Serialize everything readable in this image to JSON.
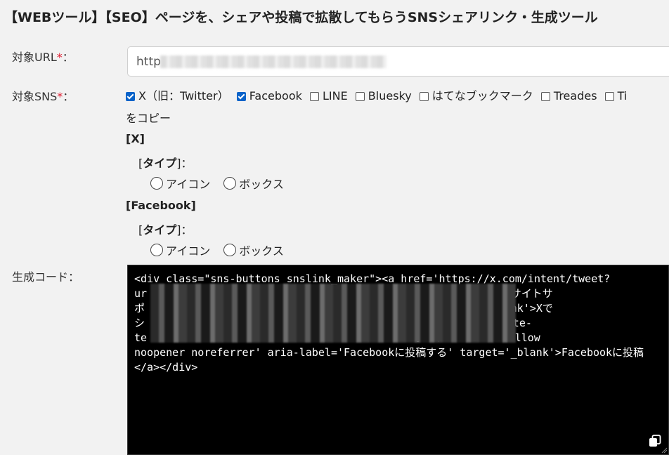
{
  "page": {
    "title": "【WEBツール】【SEO】ページを、シェアや投稿で拡散してもらうSNSシェアリンク・生成ツール"
  },
  "form": {
    "url": {
      "label": "対象URL",
      "required_mark": "*",
      "colon": "：",
      "value_visible": "http"
    },
    "sns": {
      "label": "対象SNS",
      "required_mark": "*",
      "colon": "：",
      "options": [
        {
          "label": "X（旧：Twitter）",
          "checked": true
        },
        {
          "label": "Facebook",
          "checked": true
        },
        {
          "label": "LINE",
          "checked": false
        },
        {
          "label": "Bluesky",
          "checked": false
        },
        {
          "label": "はてなブックマーク",
          "checked": false
        },
        {
          "label": "Treades",
          "checked": false
        },
        {
          "label": "Ti",
          "checked": false
        }
      ],
      "wrap_text": "をコピー"
    },
    "sections": [
      {
        "heading": "[X]",
        "type_open": "[",
        "type_label": "タイプ",
        "type_close": "]：",
        "radios": [
          "アイコン",
          "ボックス"
        ]
      },
      {
        "heading": "[Facebook]",
        "type_open": "[",
        "type_label": "タイプ",
        "type_close": "]：",
        "radios": [
          "アイコン",
          "ボックス"
        ]
      }
    ],
    "code": {
      "label": "生成コード：",
      "lines": [
        "<div class=\"sns-buttons snslink_maker\"><a href='https://x.com/intent/tweet?",
        "ur                                          ート' title='WEBサイトサ",
        "ポ                                          ア' target='_blank'>Xで",
        "シ                                          ?u=https://website-",
        "te                                          ポート' rel='nofollow",
        "noopener noreferrer' aria-label='Facebookに投稿する' target='_blank'>Facebookに投稿",
        "</a></div>"
      ]
    }
  },
  "icons": {
    "copy": "copy-icon",
    "resize": "resize-grip-icon"
  },
  "colors": {
    "checkbox_checked": "#0a63c9",
    "required": "#e0182d",
    "code_bg": "#000000"
  }
}
